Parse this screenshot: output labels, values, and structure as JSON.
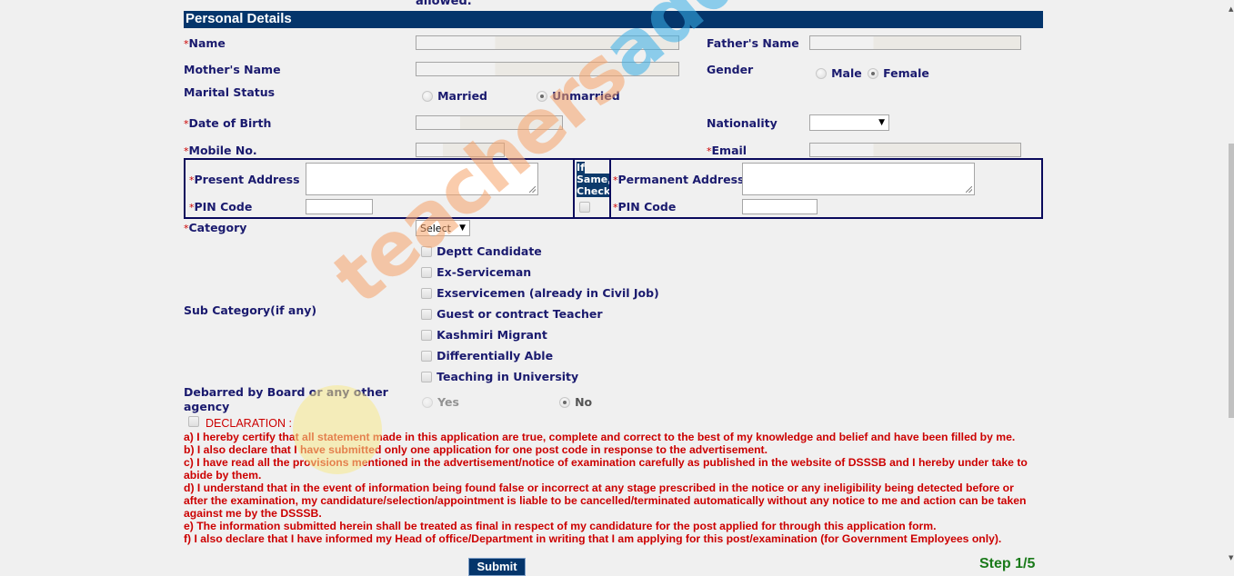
{
  "header": {
    "top_overflow_text": "allowed.",
    "section_title": "Personal Details"
  },
  "colors": {
    "section_bar": "#04356b",
    "label_text": "#1a1a6e",
    "required_mark": "#cc0000",
    "declaration_text": "#cc0000",
    "step_text": "#1a7a1a"
  },
  "required_mark": "*",
  "fields": {
    "name": {
      "label": "Name",
      "required": true,
      "value": ""
    },
    "fathers_name": {
      "label": "Father's Name",
      "required": false,
      "value": ""
    },
    "mothers_name": {
      "label": "Mother's Name",
      "required": false,
      "value": ""
    },
    "gender": {
      "label": "Gender",
      "options": [
        "Male",
        "Female"
      ],
      "selected": "Female"
    },
    "marital_status": {
      "label": "Marital Status",
      "options": [
        "Married",
        "Unmarried"
      ],
      "selected": "Unmarried"
    },
    "dob": {
      "label": "Date of Birth",
      "required": true,
      "value": ""
    },
    "nationality": {
      "label": "Nationality",
      "selected": ""
    },
    "mobile": {
      "label": "Mobile No.",
      "required": true,
      "value": ""
    },
    "email": {
      "label": "Email",
      "required": true,
      "value": ""
    },
    "present_address": {
      "label": "Present Address",
      "required": true,
      "value": ""
    },
    "present_pin": {
      "label": "PIN Code",
      "required": true,
      "value": ""
    },
    "same_check": {
      "label_line1": "If",
      "label_line2": "Same,",
      "label_line3": "Check",
      "checked": false
    },
    "permanent_address": {
      "label": "Permanent Address",
      "required": true,
      "value": ""
    },
    "permanent_pin": {
      "label": "PIN Code",
      "required": true,
      "value": ""
    },
    "category": {
      "label": "Category",
      "required": true,
      "selected": "Select"
    },
    "sub_category": {
      "label": "Sub Category(if any)",
      "options": [
        {
          "label": "Deptt Candidate",
          "checked": false
        },
        {
          "label": "Ex-Serviceman",
          "checked": false
        },
        {
          "label": "Exservicemen (already in Civil Job)",
          "checked": false
        },
        {
          "label": "Guest or contract Teacher",
          "checked": false
        },
        {
          "label": "Kashmiri Migrant",
          "checked": false
        },
        {
          "label": "Differentially Able",
          "checked": false
        },
        {
          "label": "Teaching in University",
          "checked": false
        }
      ]
    },
    "debarred": {
      "label_line1": "Debarred by Board or any other",
      "label_line2": "agency",
      "options": [
        "Yes",
        "No"
      ],
      "selected": "No"
    }
  },
  "declaration": {
    "heading": "DECLARATION :",
    "checked": false,
    "lines": [
      "a) I hereby certify that all statement made in this application are true, complete and correct to the best of my knowledge and belief and have been filled by me.",
      "b) I also declare that I have submitted only one application for one post code in response to the advertisement.",
      "c) I have read all the provisions mentioned in the advertisement/notice of examination carefully as published in the website of DSSSB and I hereby under take to abide by them.",
      "d) I understand that in the event of information being found false or incorrect at any stage prescribed in the notice or any ineligibility being detected before or after the examination, my candidature/selection/appointment is liable to be cancelled/terminated automatically without any notice to me and action can be taken against me by the DSSSB.",
      "e) The information submitted herein shall be treated as final in respect of my candidature for the post applied for through this application form.",
      "f) I also declare that I have informed my Head of office/Department in writing that I am applying for this post/examination (for Government Employees only)."
    ]
  },
  "footer": {
    "submit_label": "Submit",
    "step_text": "Step 1/5"
  },
  "watermark": {
    "part1": "teachers",
    "part2": "adda.co.in"
  },
  "icons": {
    "dropdown_arrow": "▼",
    "scroll_up": "▲",
    "scroll_down": "▼"
  }
}
